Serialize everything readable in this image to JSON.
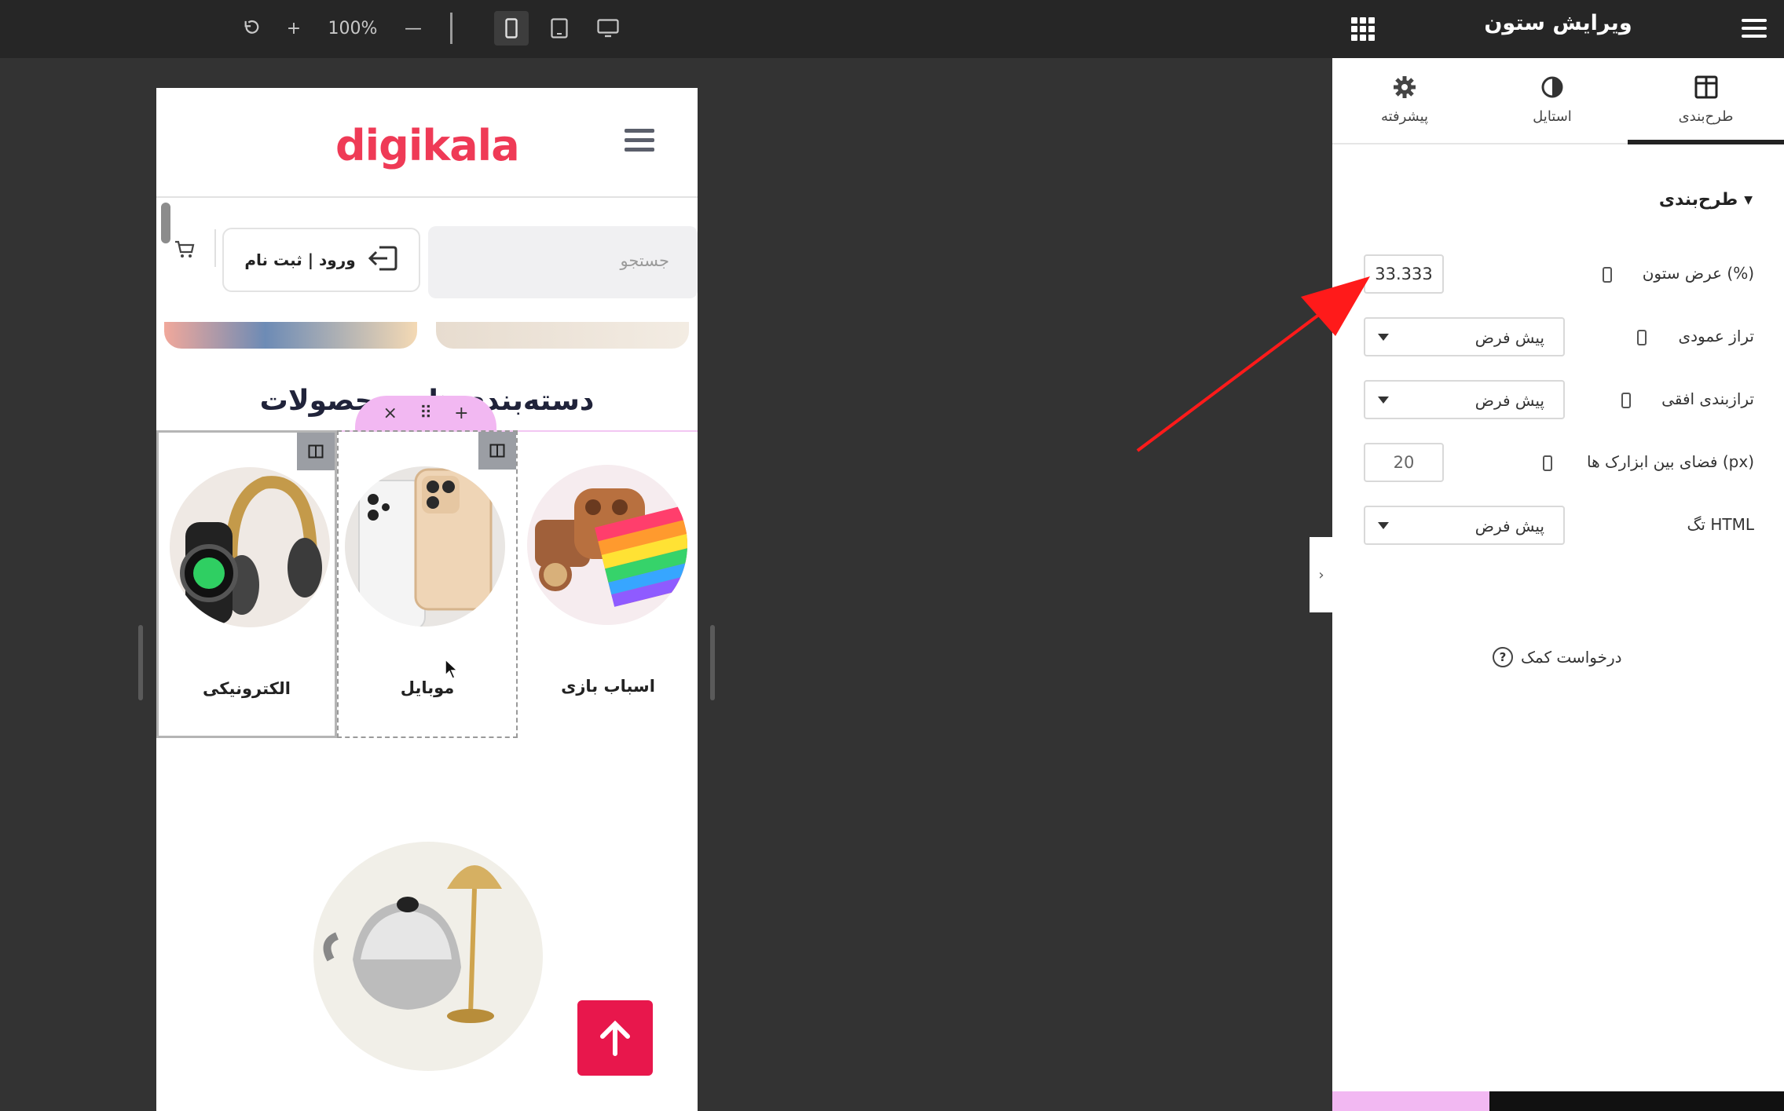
{
  "toolbar": {
    "undo_icon": "undo-icon",
    "zoom_in": "+",
    "zoom_level": "100%",
    "zoom_out": "—",
    "devices": [
      "mobile-icon",
      "tablet-icon",
      "desktop-icon"
    ],
    "active_device": "mobile"
  },
  "site": {
    "logo": "digikala",
    "search_placeholder": "جستجو",
    "login_label": "ورود | ثبت نام",
    "section_title": "دسته‌بندی‌های محصولات",
    "categories": [
      {
        "label": "الکترونیکی"
      },
      {
        "label": "موبایل"
      },
      {
        "label": "اسباب بازی"
      }
    ],
    "column_toolbar": {
      "close": "×",
      "drag": "⠿",
      "add": "+"
    }
  },
  "panel": {
    "title": "ویرایش ستون",
    "tabs": [
      {
        "label": "طرح‌بندی",
        "icon": "columns-icon",
        "active": true
      },
      {
        "label": "استایل",
        "icon": "contrast-icon",
        "active": false
      },
      {
        "label": "پیشرفته",
        "icon": "gear-icon",
        "active": false
      }
    ],
    "section": "طرح‌بندی",
    "fields": {
      "column_width_label": "عرض ستون (%)",
      "column_width_value": "33.333",
      "vertical_align_label": "تراز عمودی",
      "vertical_align_value": "پیش فرض",
      "horizontal_align_label": "ترازبندی افقی",
      "horizontal_align_value": "پیش فرض",
      "widget_space_label": "فضای بین ابزارک ها (px)",
      "widget_space_value": "20",
      "html_tag_label": "تگ HTML",
      "html_tag_value": "پیش فرض"
    },
    "help": "درخواست کمک"
  },
  "colors": {
    "brand": "#ef3a56",
    "accent_pink": "#f2b8f2",
    "scroll_up": "#e8174c",
    "arrow": "#ff1a1a"
  }
}
